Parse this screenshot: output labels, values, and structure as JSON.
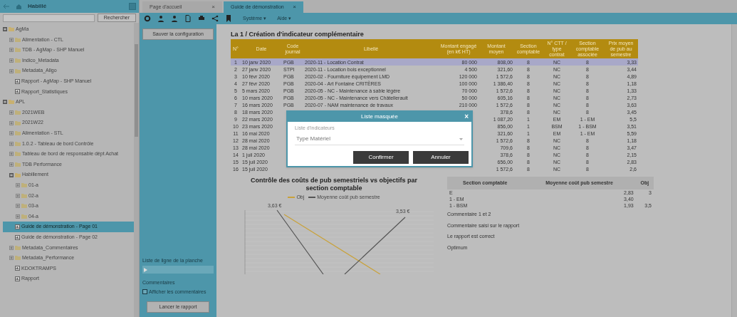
{
  "sidebar": {
    "title": "Habillé",
    "search": {
      "button": "Rechercher"
    },
    "tree": [
      {
        "label": "AgMa",
        "kind": "folder",
        "expanded": true,
        "selected": false,
        "children": [
          {
            "label": "Alimentation - CTL",
            "kind": "folder",
            "expanded": false,
            "selected": false
          },
          {
            "label": "TDB - AgMap - SHP Manuel",
            "kind": "folder",
            "expanded": false,
            "selected": false
          },
          {
            "label": "Indico_Metadata",
            "kind": "folder",
            "expanded": false,
            "selected": false
          },
          {
            "label": "Metadata_Allgo",
            "kind": "folder",
            "expanded": false,
            "selected": false
          },
          {
            "label": "Rapport - AgMap - SHP Manuel",
            "kind": "report",
            "selected": false
          },
          {
            "label": "Rapport_Statistiques",
            "kind": "report",
            "selected": false
          }
        ]
      },
      {
        "label": "APL",
        "kind": "folder",
        "expanded": true,
        "selected": false,
        "children": [
          {
            "label": "2021WEB",
            "kind": "folder",
            "expanded": false,
            "selected": false
          },
          {
            "label": "2021W22",
            "kind": "folder",
            "expanded": false,
            "selected": false
          },
          {
            "label": "Alimentation - STL",
            "kind": "folder",
            "expanded": false,
            "selected": false
          },
          {
            "label": "1.0.2 - Tableau de bord Contrôle",
            "kind": "folder",
            "expanded": false,
            "selected": false
          },
          {
            "label": "Tableau de bord de responsable dépt Achat",
            "kind": "folder",
            "expanded": false,
            "selected": false
          },
          {
            "label": "TDB Performance",
            "kind": "folder",
            "expanded": false,
            "selected": false
          },
          {
            "label": "Habillement",
            "kind": "folder",
            "expanded": true,
            "selected": false,
            "children": [
              {
                "label": "01-a",
                "kind": "folder",
                "expanded": false,
                "selected": false
              },
              {
                "label": "02-a",
                "kind": "folder",
                "expanded": false,
                "selected": false
              },
              {
                "label": "03-a",
                "kind": "folder",
                "expanded": false,
                "selected": false
              },
              {
                "label": "04-a",
                "kind": "folder",
                "expanded": false,
                "selected": false
              }
            ]
          },
          {
            "label": "Guide de démonstration - Page 01",
            "kind": "report",
            "selected": true
          },
          {
            "label": "Guide de démonstration - Page 02",
            "kind": "report",
            "selected": false
          },
          {
            "label": "Metadata_Commentaires",
            "kind": "folder",
            "expanded": false,
            "selected": false
          },
          {
            "label": "Metadata_Performance",
            "kind": "folder",
            "expanded": false,
            "selected": false
          },
          {
            "label": "KDOKTRAMPS",
            "kind": "report",
            "selected": false
          },
          {
            "label": "Rapport",
            "kind": "report",
            "selected": false
          }
        ]
      }
    ]
  },
  "tabs": [
    {
      "label": "Page d'accueil",
      "selected": false,
      "close": "×"
    },
    {
      "label": "Guide de démonstration",
      "selected": true,
      "close": "×"
    }
  ],
  "toolbar": {
    "menus": [
      {
        "label": "Système ▾"
      },
      {
        "label": "Aide ▾"
      }
    ]
  },
  "config_panel": {
    "save_button": "Sauver la configuration",
    "line_label": "Liste de ligne de la planche",
    "comments_label": "Commentaires",
    "show_comments": {
      "label": "Afficher les commentaires",
      "checked": false
    },
    "run_button": "Lancer le rapport"
  },
  "report": {
    "title": "La 1 / Création d'indicateur complémentaire",
    "columns": [
      "N°",
      "Date",
      "Code journal",
      "Libellé",
      "Montant engagé (en k€ HT)",
      "Montant moyen",
      "Section comptable",
      "N° CTT / type contrat",
      "Section comptable associée",
      "Prix moyen de pub au semestre"
    ],
    "rows": [
      {
        "cells": [
          "1",
          "10 janv 2020",
          "PGB",
          "2020-11 - Location Contrat",
          "80 000",
          "808,00",
          "8",
          "NC",
          "8",
          "3,33"
        ],
        "selected": true
      },
      {
        "cells": [
          "2",
          "27 janv 2020",
          "STPI",
          "2020-11 - Location bois exceptionnel",
          "4 500",
          "321,60",
          "8",
          "NC",
          "8",
          "3,44"
        ],
        "selected": false
      },
      {
        "cells": [
          "3",
          "10 févr 2020",
          "PGB",
          "2020-02 - Fourniture équipement LMD",
          "120 000",
          "1 572,6",
          "8",
          "NC",
          "8",
          "4,89"
        ],
        "selected": false
      },
      {
        "cells": [
          "4",
          "27 févr 2020",
          "PGB",
          "2020-04 - Art Fontaine CRITÈRES",
          "100 000",
          "1 386,40",
          "8",
          "NC",
          "8",
          "1,18"
        ],
        "selected": false
      },
      {
        "cells": [
          "5",
          "5 mars 2020",
          "PGB",
          "2020-05 - NC - Maintenance à sable légère",
          "70 000",
          "1 572,6",
          "8",
          "NC",
          "8",
          "1,33"
        ],
        "selected": false
      },
      {
        "cells": [
          "6",
          "10 mars 2020",
          "PGB",
          "2020-05 - NC - Maintenance vers Châtellerault",
          "50 000",
          "605,16",
          "8",
          "NC",
          "8",
          "2,73"
        ],
        "selected": false
      },
      {
        "cells": [
          "7",
          "16 mars 2020",
          "PGB",
          "2020-07 - NAM maintenance de travaux",
          "210 000",
          "1 572,6",
          "8",
          "NC",
          "8",
          "3,63"
        ],
        "selected": false
      },
      {
        "cells": [
          "8",
          "18 mars 2020",
          "",
          "",
          "",
          "378,6",
          "8",
          "NC",
          "8",
          "3,45"
        ],
        "selected": false
      },
      {
        "cells": [
          "9",
          "22 mars 2020",
          "",
          "",
          "",
          "1 087,20",
          "1",
          "EM",
          "1 - EM",
          "5,5"
        ],
        "selected": false
      },
      {
        "cells": [
          "10",
          "23 mars 2020",
          "",
          "",
          "",
          "856,00",
          "1",
          "BSM",
          "1 - BSM",
          "3,51"
        ],
        "selected": false
      },
      {
        "cells": [
          "11",
          "16 mai 2020",
          "",
          "",
          "",
          "321,60",
          "1",
          "EM",
          "1 - EM",
          "5,59"
        ],
        "selected": false
      },
      {
        "cells": [
          "12",
          "28 mai 2020",
          "",
          "",
          "",
          "1 572,6",
          "8",
          "NC",
          "8",
          "1,18"
        ],
        "selected": false
      },
      {
        "cells": [
          "13",
          "28 mai 2020",
          "",
          "",
          "",
          "709,6",
          "8",
          "NC",
          "8",
          "3,47"
        ],
        "selected": false
      },
      {
        "cells": [
          "14",
          "1 juil 2020",
          "",
          "",
          "",
          "378,6",
          "8",
          "NC",
          "8",
          "2,15"
        ],
        "selected": false
      },
      {
        "cells": [
          "15",
          "15 juil 2020",
          "",
          "",
          "",
          "656,00",
          "8",
          "NC",
          "8",
          "2,83"
        ],
        "selected": false
      },
      {
        "cells": [
          "16",
          "15 juil 2020",
          "",
          "",
          "",
          "1 572,6",
          "8",
          "NC",
          "8",
          "2,6"
        ],
        "selected": false
      }
    ],
    "chart": {
      "title": "Contrôle des coûts de pub semestriels vs objectifs par section comptable",
      "legend": [
        {
          "label": "Obj",
          "color": "#c9a23a"
        },
        {
          "label": "Moyenne coût pub semestre",
          "color": "#555555"
        }
      ],
      "point_labels": [
        "3,63 €",
        "3,53 €"
      ]
    },
    "summary": {
      "columns": [
        "Section comptable",
        "Moyenne coût pub semestre",
        "Obj"
      ],
      "rows": [
        [
          "E",
          "2,83",
          "3"
        ],
        [
          "1 - EM",
          "3,40",
          ""
        ],
        [
          "1 - BSM",
          "1,93",
          "3,5"
        ]
      ]
    },
    "notes": [
      "Commentaire 1 et 2",
      "Commentaire saisi sur le rapport",
      "Le rapport est correct",
      "Optimum"
    ]
  },
  "dialog": {
    "title": "Liste masquée",
    "field_label": "Liste d'indicateurs",
    "field_value": "Type Matériel",
    "buttons": [
      "Confirmer",
      "Annuler"
    ],
    "close": "×"
  }
}
